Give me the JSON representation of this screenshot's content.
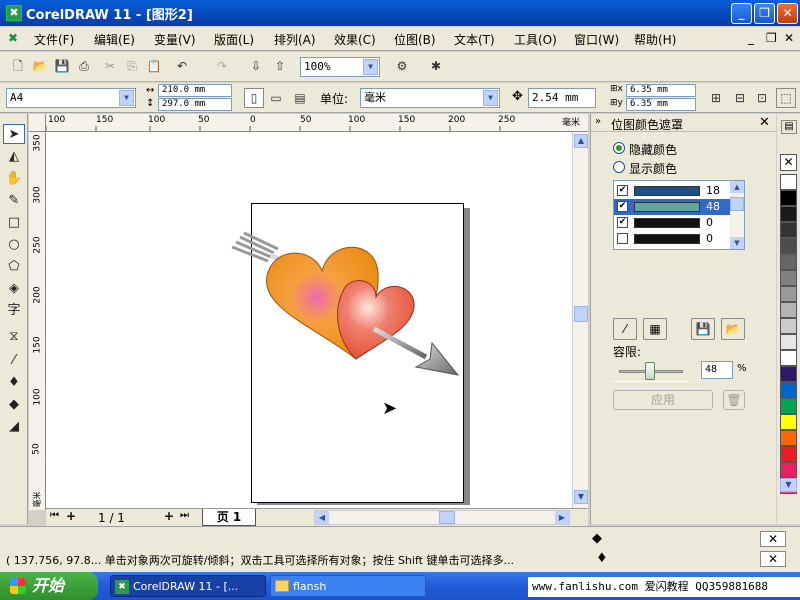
{
  "window": {
    "title": "CorelDRAW 11 - [图形2]"
  },
  "menu": [
    "文件(F)",
    "编辑(E)",
    "变量(V)",
    "版面(L)",
    "排列(A)",
    "效果(C)",
    "位图(B)",
    "文本(T)",
    "工具(O)",
    "窗口(W)",
    "帮助(H)"
  ],
  "toolbar": {
    "zoom": "100%"
  },
  "propbar": {
    "page_size": "A4",
    "width": "210.0 mm",
    "height": "297.0 mm",
    "unit_label": "单位:",
    "unit": "毫米",
    "nudge": "2.54 mm",
    "dup_x": "6.35 mm",
    "dup_y": "6.35 mm"
  },
  "ruler_h": {
    "labels": [
      "100",
      "150",
      "100",
      "50",
      "0",
      "50",
      "100",
      "150",
      "200",
      "250"
    ],
    "unit": "毫米"
  },
  "ruler_v": {
    "labels": [
      "350",
      "300",
      "250",
      "200",
      "150",
      "100",
      "50"
    ],
    "unit": "毫米"
  },
  "pagebar": {
    "count": "1 / 1",
    "tab": "页 1"
  },
  "docker": {
    "title": "位图颜色遮罩",
    "hide_colors": "隐藏颜色",
    "show_colors": "显示颜色",
    "color_rows": [
      {
        "checked": true,
        "color": "#1a4f8a",
        "value": "18"
      },
      {
        "checked": true,
        "color": "#5fa89a",
        "value": "48"
      },
      {
        "checked": true,
        "color": "#111111",
        "value": "0"
      },
      {
        "checked": false,
        "color": "#111111",
        "value": "0"
      }
    ],
    "tolerance_label": "容限:",
    "tolerance_value": "48",
    "tolerance_unit": "%",
    "tolerance_fraction": 0.48,
    "apply": "应用"
  },
  "palette": [
    "#ffffff",
    "#000000",
    "#1a1a1a",
    "#333333",
    "#4d4d4d",
    "#666666",
    "#808080",
    "#999999",
    "#b3b3b3",
    "#cccccc",
    "#e6e6e6",
    "#ffffff",
    "#2b1a6b",
    "#0066cc",
    "#00a651",
    "#ffff00",
    "#ff6600",
    "#ed1c24",
    "#e91e63",
    "#ff4081"
  ],
  "status": {
    "text": "( 137.756, 97.8...  单击对象两次可旋转/倾斜；双击工具可选择所有对象；按住 Shift 键单击可选择多..."
  },
  "taskbar": {
    "start": "开始",
    "task1": "CorelDRAW 11 - [...",
    "task2": "flansh",
    "tray": "www.fanlishu.com 爱闪教程 QQ359881688"
  }
}
